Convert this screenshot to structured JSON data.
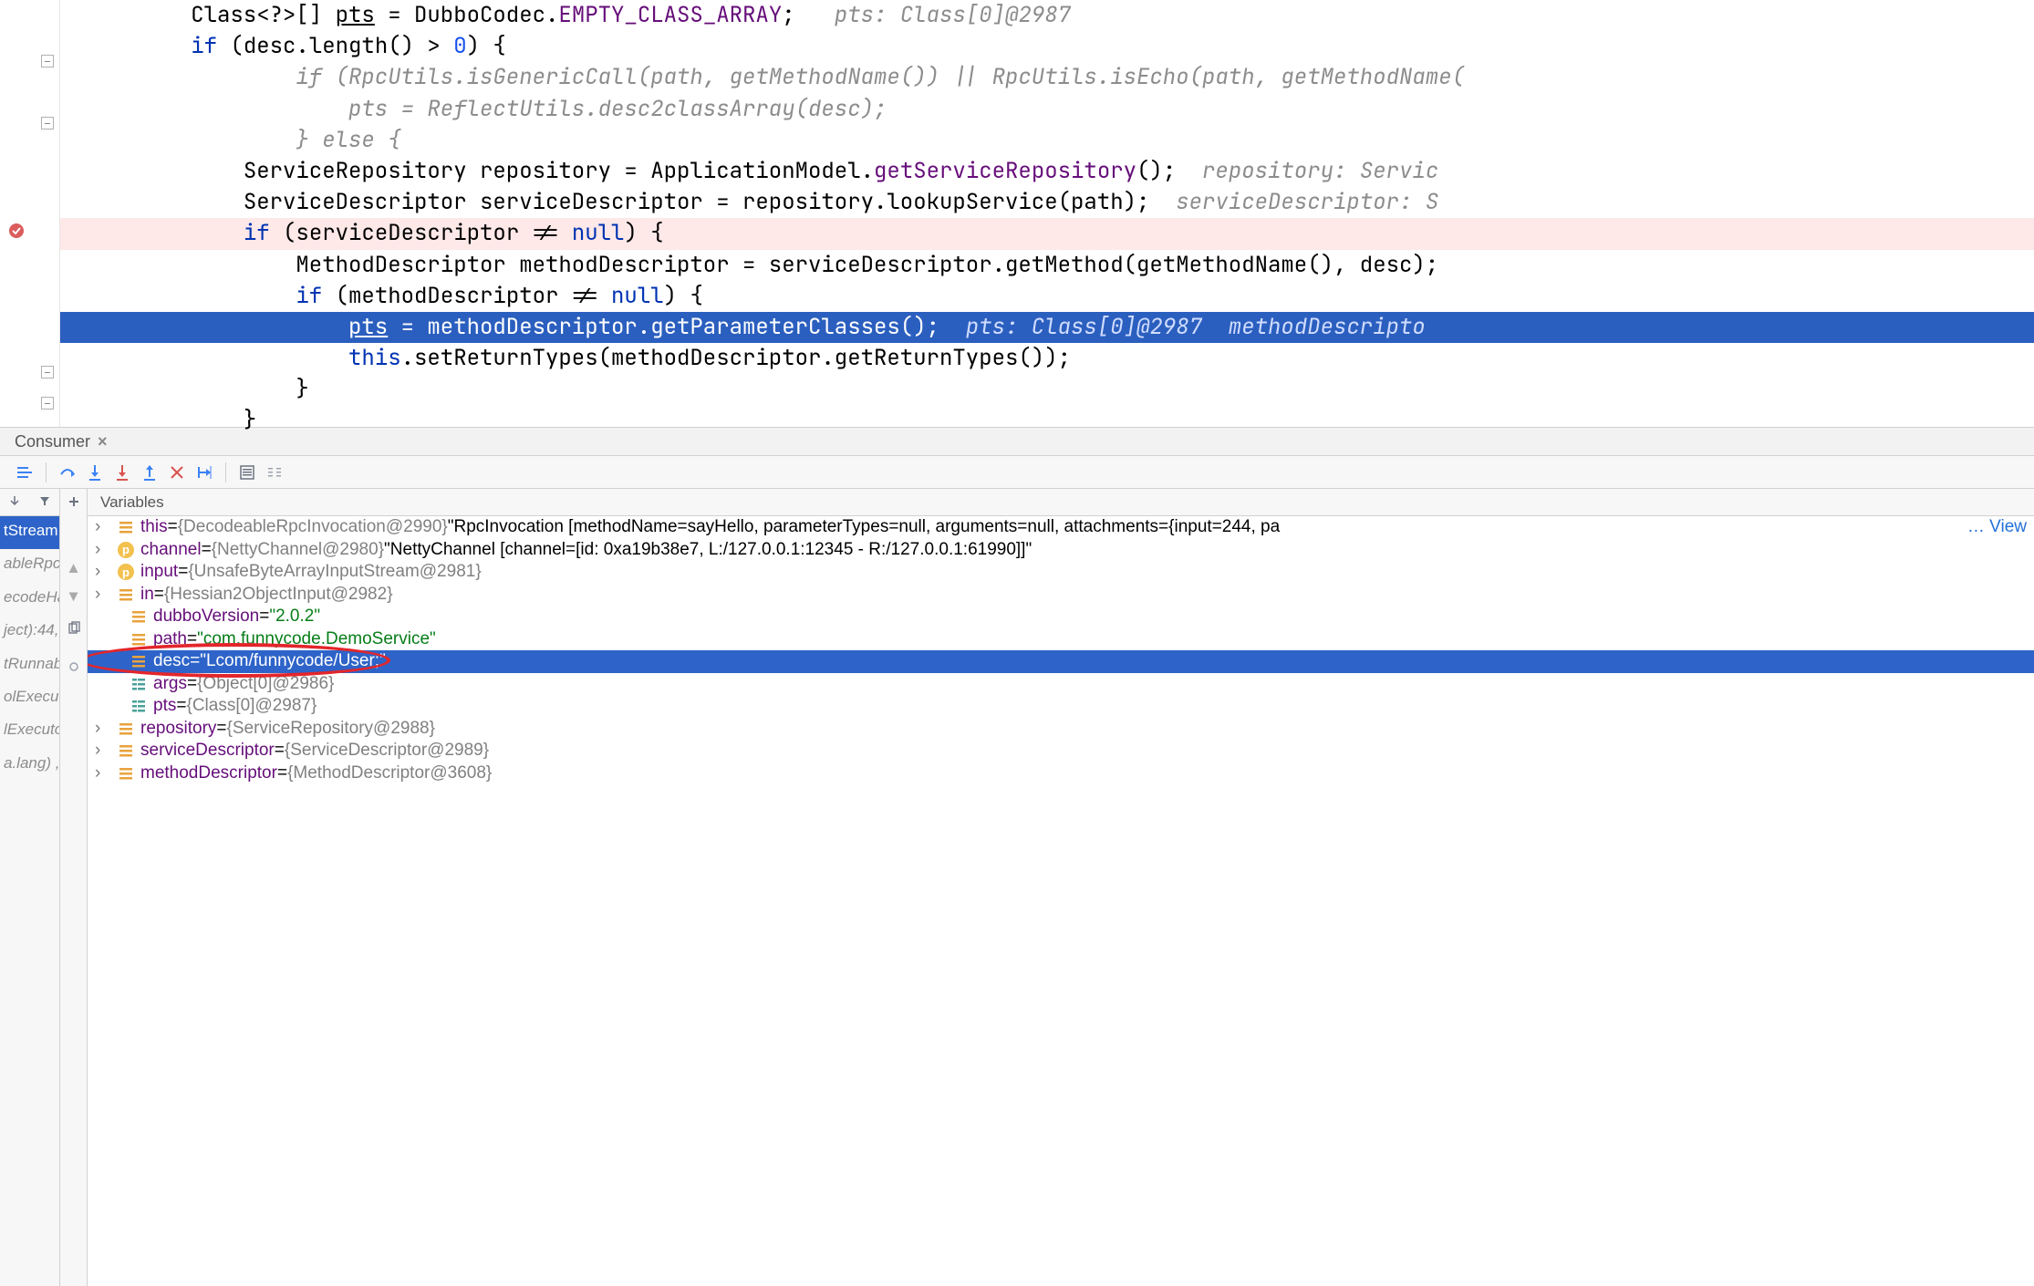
{
  "editor": {
    "lines": [
      {
        "indent": 2,
        "segs": [
          {
            "t": "Class<?>[] ",
            "c": ""
          },
          {
            "t": "pts",
            "c": "ul"
          },
          {
            "t": " = DubboCodec.",
            "c": ""
          },
          {
            "t": "EMPTY_CLASS_ARRAY",
            "c": "field"
          },
          {
            "t": ";   ",
            "c": ""
          },
          {
            "t": "pts: Class[0]@2987",
            "c": "hint"
          }
        ]
      },
      {
        "indent": 2,
        "segs": [
          {
            "t": "if",
            "c": "kw"
          },
          {
            "t": " (desc.length() > ",
            "c": ""
          },
          {
            "t": "0",
            "c": "num"
          },
          {
            "t": ") {",
            "c": ""
          }
        ]
      },
      {
        "indent": 4,
        "segs": [
          {
            "t": "if (RpcUtils.isGenericCall(path, getMethodName()) || RpcUtils.isEcho(path, getMethodName(",
            "c": "cmt"
          }
        ]
      },
      {
        "indent": 5,
        "segs": [
          {
            "t": "pts = ReflectUtils.desc2classArray(desc);",
            "c": "cmt"
          }
        ]
      },
      {
        "indent": 4,
        "segs": [
          {
            "t": "} else {",
            "c": "cmt"
          }
        ]
      },
      {
        "indent": 3,
        "segs": [
          {
            "t": "ServiceRepository repository = ApplicationModel.",
            "c": ""
          },
          {
            "t": "getServiceRepository",
            "c": "field"
          },
          {
            "t": "();  ",
            "c": ""
          },
          {
            "t": "repository: Servic",
            "c": "hint"
          }
        ]
      },
      {
        "indent": 3,
        "segs": [
          {
            "t": "ServiceDescriptor serviceDescriptor = repository.lookupService(path);  ",
            "c": ""
          },
          {
            "t": "serviceDescriptor: S",
            "c": "hint"
          }
        ]
      },
      {
        "indent": 3,
        "bp": true,
        "segs": [
          {
            "t": "if",
            "c": "kw"
          },
          {
            "t": " (serviceDescriptor != ",
            "c": ""
          },
          {
            "t": "null",
            "c": "kw"
          },
          {
            "t": ") {",
            "c": ""
          }
        ]
      },
      {
        "indent": 4,
        "segs": [
          {
            "t": "MethodDescriptor methodDescriptor = serviceDescriptor.getMethod(getMethodName(), desc);",
            "c": ""
          }
        ]
      },
      {
        "indent": 4,
        "segs": [
          {
            "t": "if",
            "c": "kw"
          },
          {
            "t": " (methodDescriptor != ",
            "c": ""
          },
          {
            "t": "null",
            "c": "kw"
          },
          {
            "t": ") {",
            "c": ""
          }
        ]
      },
      {
        "indent": 5,
        "current": true,
        "segs": [
          {
            "t": "pts",
            "c": "ul"
          },
          {
            "t": " = methodDescriptor.getParameterClasses();  ",
            "c": ""
          },
          {
            "t": "pts: Class[0]@2987  methodDescripto",
            "c": "hint"
          }
        ]
      },
      {
        "indent": 5,
        "segs": [
          {
            "t": "this",
            "c": "kw"
          },
          {
            "t": ".setReturnTypes(methodDescriptor.getReturnTypes());",
            "c": ""
          }
        ]
      },
      {
        "indent": 4,
        "segs": [
          {
            "t": "}",
            "c": ""
          }
        ]
      },
      {
        "indent": 3,
        "segs": [
          {
            "t": "}",
            "c": ""
          }
        ]
      }
    ]
  },
  "debug_tab": {
    "label": "Consumer"
  },
  "variables_header": "Variables",
  "frames": [
    "tStream",
    "ableRpcI",
    "ecodeHa",
    "ject):44,",
    "tRunnab",
    "olExecuto",
    "lExecuto",
    "a.lang) ,"
  ],
  "vars": [
    {
      "chev": true,
      "icon": "f",
      "name": "this",
      "obj": "{DecodeableRpcInvocation@2990}",
      "tail": " \"RpcInvocation [methodName=sayHello, parameterTypes=null, arguments=null, attachments={input=244, pa",
      "viewlink": "… View"
    },
    {
      "chev": true,
      "icon": "p",
      "name": "channel",
      "obj": "{NettyChannel@2980}",
      "tail": " \"NettyChannel [channel=[id: 0xa19b38e7, L:/127.0.0.1:12345 - R:/127.0.0.1:61990]]\""
    },
    {
      "chev": true,
      "icon": "p",
      "name": "input",
      "obj": "{UnsafeByteArrayInputStream@2981}"
    },
    {
      "chev": true,
      "icon": "f",
      "name": "in",
      "obj": "{Hessian2ObjectInput@2982}"
    },
    {
      "chev": false,
      "icon": "f",
      "name": "dubboVersion",
      "str": "\"2.0.2\""
    },
    {
      "chev": false,
      "icon": "f",
      "name": "path",
      "str": "\"com.funnycode.DemoService\""
    },
    {
      "chev": false,
      "icon": "f",
      "name": "desc",
      "str": "\"Lcom/funnycode/User;\"",
      "selected": true
    },
    {
      "chev": false,
      "icon": "t",
      "name": "args",
      "obj": "{Object[0]@2986}"
    },
    {
      "chev": false,
      "icon": "t",
      "name": "pts",
      "obj": "{Class[0]@2987}"
    },
    {
      "chev": true,
      "icon": "f",
      "name": "repository",
      "obj": "{ServiceRepository@2988}"
    },
    {
      "chev": true,
      "icon": "f",
      "name": "serviceDescriptor",
      "obj": "{ServiceDescriptor@2989}"
    },
    {
      "chev": true,
      "icon": "f",
      "name": "methodDescriptor",
      "obj": "{MethodDescriptor@3608}"
    }
  ]
}
